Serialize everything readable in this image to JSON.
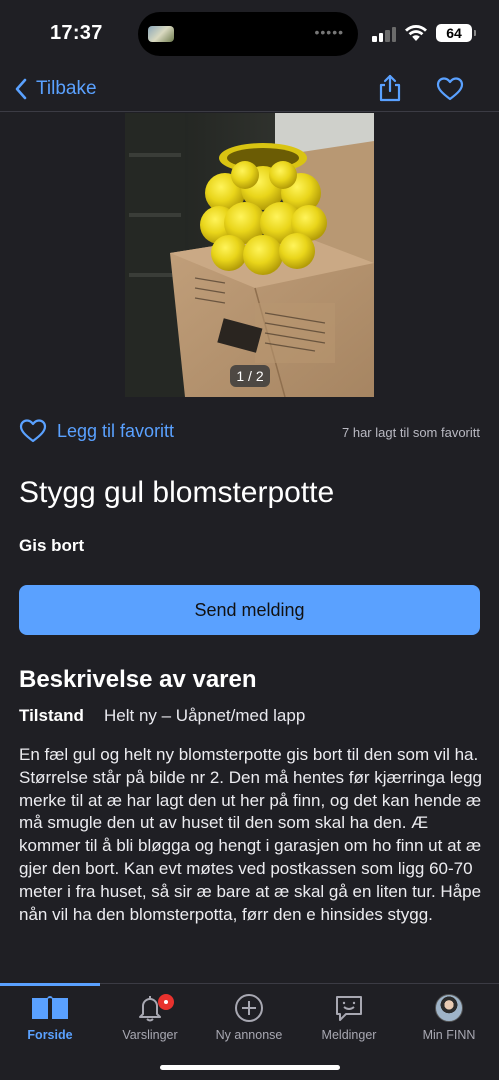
{
  "status_bar": {
    "time": "17:37",
    "battery": "64"
  },
  "nav": {
    "back_label": "Tilbake"
  },
  "photo": {
    "counter": "1 / 2"
  },
  "favorite": {
    "label": "Legg til favoritt",
    "count_text": "7 har lagt til som favoritt"
  },
  "listing": {
    "title": "Stygg gul blomsterpotte",
    "price": "Gis bort",
    "send_button": "Send melding"
  },
  "description": {
    "heading": "Beskrivelse av varen",
    "condition_label": "Tilstand",
    "condition_value": "Helt ny – Uåpnet/med lapp",
    "body": "En fæl gul og helt ny blomsterpotte gis bort til den som vil ha. Størrelse står på bilde nr 2. Den må hentes før kjærringa legg merke til at æ har lagt den ut her på finn, og det kan hende æ må smugle den ut av huset til den som skal ha den. Æ kommer til å bli bløgga og hengt i garasjen om ho finn ut at æ gjer den bort. Kan evt møtes ved postkassen som ligg 60-70 meter i fra huset, så sir æ bare at æ skal gå en liten tur. Håpe nån vil ha den blomsterpotta, førr den e hinsides stygg."
  },
  "tabbar": {
    "tabs": [
      {
        "label": "Forside",
        "icon": "home-icon",
        "active": true
      },
      {
        "label": "Varslinger",
        "icon": "bell-icon",
        "badge": true
      },
      {
        "label": "Ny annonse",
        "icon": "plus-circle-icon"
      },
      {
        "label": "Meldinger",
        "icon": "chat-icon"
      },
      {
        "label": "Min FINN",
        "icon": "avatar"
      }
    ]
  },
  "colors": {
    "accent": "#5aa1ff",
    "background": "#1f1f24",
    "badge": "#e8322e"
  }
}
